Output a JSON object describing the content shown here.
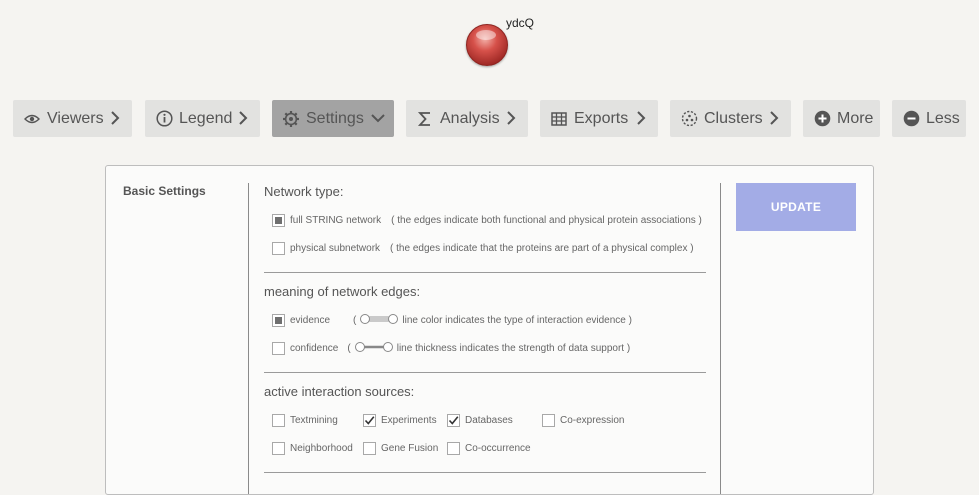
{
  "node": {
    "label": "ydcQ",
    "color": "#c43b35"
  },
  "toolbar": {
    "buttons": [
      {
        "label": "Viewers",
        "icon": "eye-icon"
      },
      {
        "label": "Legend",
        "icon": "info-icon"
      },
      {
        "label": "Settings",
        "icon": "gear-icon",
        "active": true
      },
      {
        "label": "Analysis",
        "icon": "sigma-icon"
      },
      {
        "label": "Exports",
        "icon": "table-icon"
      },
      {
        "label": "Clusters",
        "icon": "cluster-icon"
      },
      {
        "label": "More",
        "icon": "plus-circle-icon"
      },
      {
        "label": "Less",
        "icon": "minus-circle-icon"
      }
    ]
  },
  "settings": {
    "title": "Basic Settings",
    "update_label": "UPDATE",
    "update_color": "#a3ace6",
    "network_type": {
      "title": "Network type:",
      "options": [
        {
          "label": "full STRING network",
          "desc": "( the edges indicate both functional and physical protein associations )",
          "selected": true
        },
        {
          "label": "physical subnetwork",
          "desc": "( the edges indicate that the proteins are part of a physical complex )",
          "selected": false
        }
      ]
    },
    "edges": {
      "title": "meaning of network edges:",
      "options": [
        {
          "label": "evidence",
          "desc_open": "(",
          "desc": "line color indicates the type of interaction evidence )",
          "selected": true
        },
        {
          "label": "confidence",
          "desc_open": "(",
          "desc": "line thickness indicates the strength of data support )",
          "selected": false
        }
      ]
    },
    "sources": {
      "title": "active interaction sources:",
      "items": [
        {
          "label": "Textmining",
          "checked": false
        },
        {
          "label": "Experiments",
          "checked": true
        },
        {
          "label": "Databases",
          "checked": true
        },
        {
          "label": "Co-expression",
          "checked": false
        },
        {
          "label": "Neighborhood",
          "checked": false
        },
        {
          "label": "Gene Fusion",
          "checked": false
        },
        {
          "label": "Co-occurrence",
          "checked": false
        }
      ]
    }
  }
}
